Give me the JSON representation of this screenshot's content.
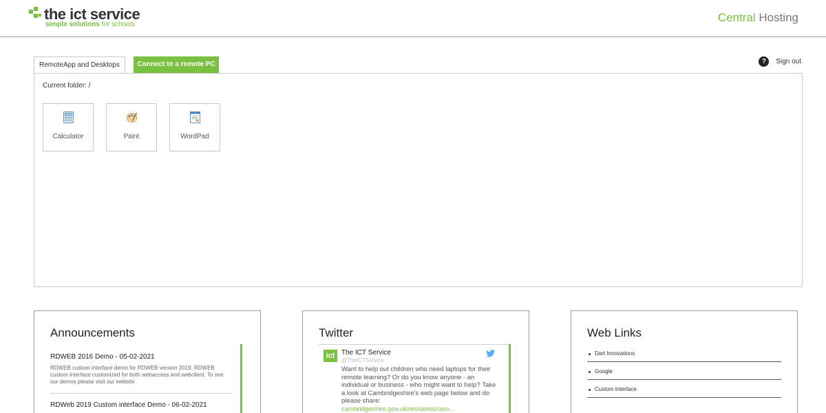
{
  "header": {
    "logo_title": "the ict service",
    "logo_tag_strong": "simple solutions",
    "logo_tag_rest": " for schools",
    "brand_accent": "Central",
    "brand_rest": " Hosting"
  },
  "tabs": {
    "remoteapp": "RemoteApp and Desktops",
    "connect": "Connect to a remote PC"
  },
  "signout": {
    "help_glyph": "?",
    "label": "Sign out"
  },
  "panel": {
    "folder_label": "Current folder: /",
    "apps": [
      {
        "label": "Calculator",
        "icon": "calculator-icon"
      },
      {
        "label": "Paint",
        "icon": "paint-icon"
      },
      {
        "label": "WordPad",
        "icon": "wordpad-icon"
      }
    ]
  },
  "announcements": {
    "title": "Announcements",
    "items": [
      {
        "title": "RDWEB 2016 Demo - 05-02-2021",
        "body": "RDWEB custom interface demo for RDWEB version 2019. RDWEB custom interface customized for both webaccess and webclient. To see our demos please visit our website"
      },
      {
        "title": "RDWeb 2019 Custom interface Demo - 06-02-2021",
        "body": ""
      }
    ]
  },
  "twitter": {
    "title": "Twitter",
    "avatar_text": "ict",
    "name": "The ICT Service",
    "handle": "@TheICTService",
    "text": "Want to help out children who need laptops for their remote learning? Or do you know anyone - an individual or business - who might want to help? Take a look at Cambridgeshire's web page below and do please share:",
    "link": "cambridgeshire.gov.uk/residents/coro…"
  },
  "weblinks": {
    "title": "Web Links",
    "items": [
      "Dart Innovations",
      "Google",
      "Custom Interface"
    ]
  },
  "colors": {
    "accent": "#7ac142",
    "text": "#333333",
    "border": "#c8c8c8"
  }
}
